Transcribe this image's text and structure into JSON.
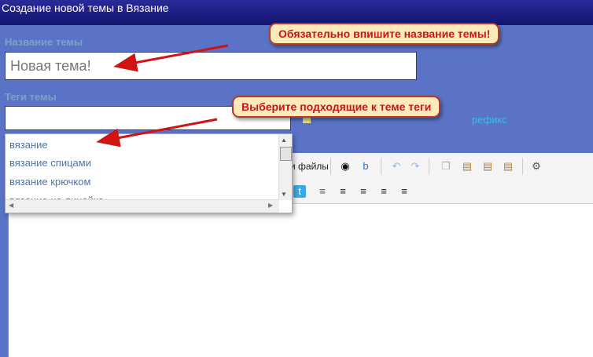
{
  "window": {
    "title": "Создание новой темы в Вязание"
  },
  "form": {
    "title_label": "Название темы",
    "title_value": "Новая тема!",
    "tags_label": "Теги темы",
    "tags_value": "",
    "prefix_text": "рефикс"
  },
  "callouts": {
    "title_hint": "Обязательно впишите название темы!",
    "tags_hint": "Выберите подходящие к теме теги"
  },
  "tag_suggestions": [
    "вязание",
    "вязание спицами",
    "вязание крючком",
    "вязание на линейке"
  ],
  "toolbar": {
    "attach_files_label": "и файлы"
  },
  "colors": {
    "callout_text": "#c4161c",
    "callout_bg": "#fcebb8",
    "page_bg": "#5a73c6",
    "titlebar": "#141470"
  }
}
